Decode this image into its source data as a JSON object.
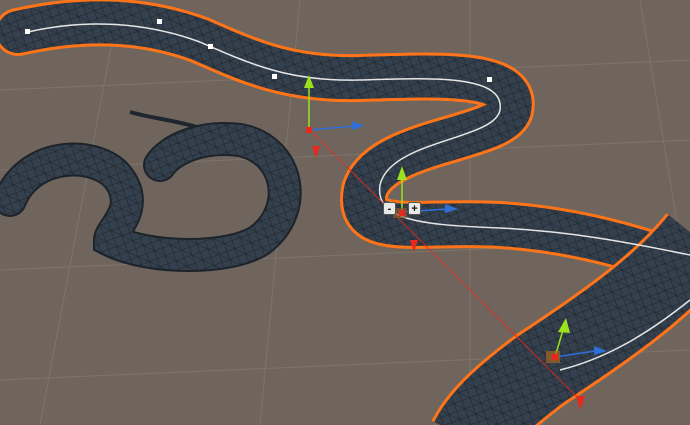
{
  "viewport": {
    "background": "#6f655d",
    "grid_color": "#7c736b",
    "mesh_color": "#34404d",
    "wire_color": "#1c242c",
    "selection_outline": "#ff7418",
    "spline_color": "#e6e6e6"
  },
  "gizmo": {
    "remove_point_label": "-",
    "add_point_label": "+",
    "y_axis_color": "#9be21c",
    "x_axis_color": "#2f6fd8",
    "z_axis_color": "#e8281c"
  }
}
